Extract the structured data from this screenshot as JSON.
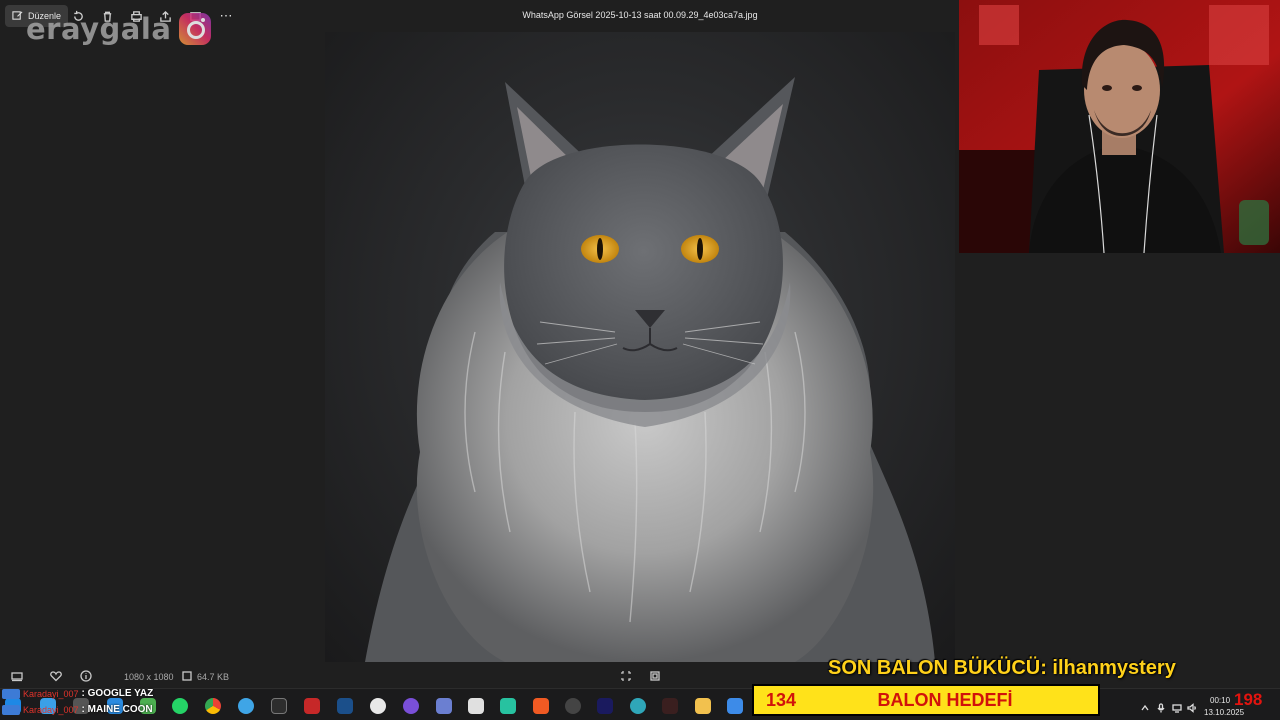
{
  "toolbar": {
    "edit_label": "Düzenle",
    "file_title": "WhatsApp Görsel 2025-10-13 saat 00.09.29_4e03ca7a.jpg"
  },
  "watermark": {
    "text": "eraygala",
    "icon": "instagram-icon"
  },
  "photo": {
    "subject": "maine-coon-cat",
    "eye_color": "#e0a524",
    "fur_color": "#9a9a9a"
  },
  "status_bar": {
    "dimensions": "1080 x 1080",
    "file_size": "64.7 KB"
  },
  "chat": [
    {
      "user": "Karadayi_007",
      "message": ": GOOGLE YAZ"
    },
    {
      "user": "Karadayi_007",
      "message": ": MAINE COON"
    }
  ],
  "balloon": {
    "title": "SON BALON BÜKÜCÜ: ilhanmystery",
    "count": "134",
    "goal_label": "BALON HEDEFİ"
  },
  "tray": {
    "time": "00:10",
    "date": "13.10.2025",
    "counter": "198"
  },
  "colors": {
    "overlay_yellow": "#ffe21a",
    "overlay_red": "#d1120b",
    "title_yellow": "#ffd11a"
  }
}
